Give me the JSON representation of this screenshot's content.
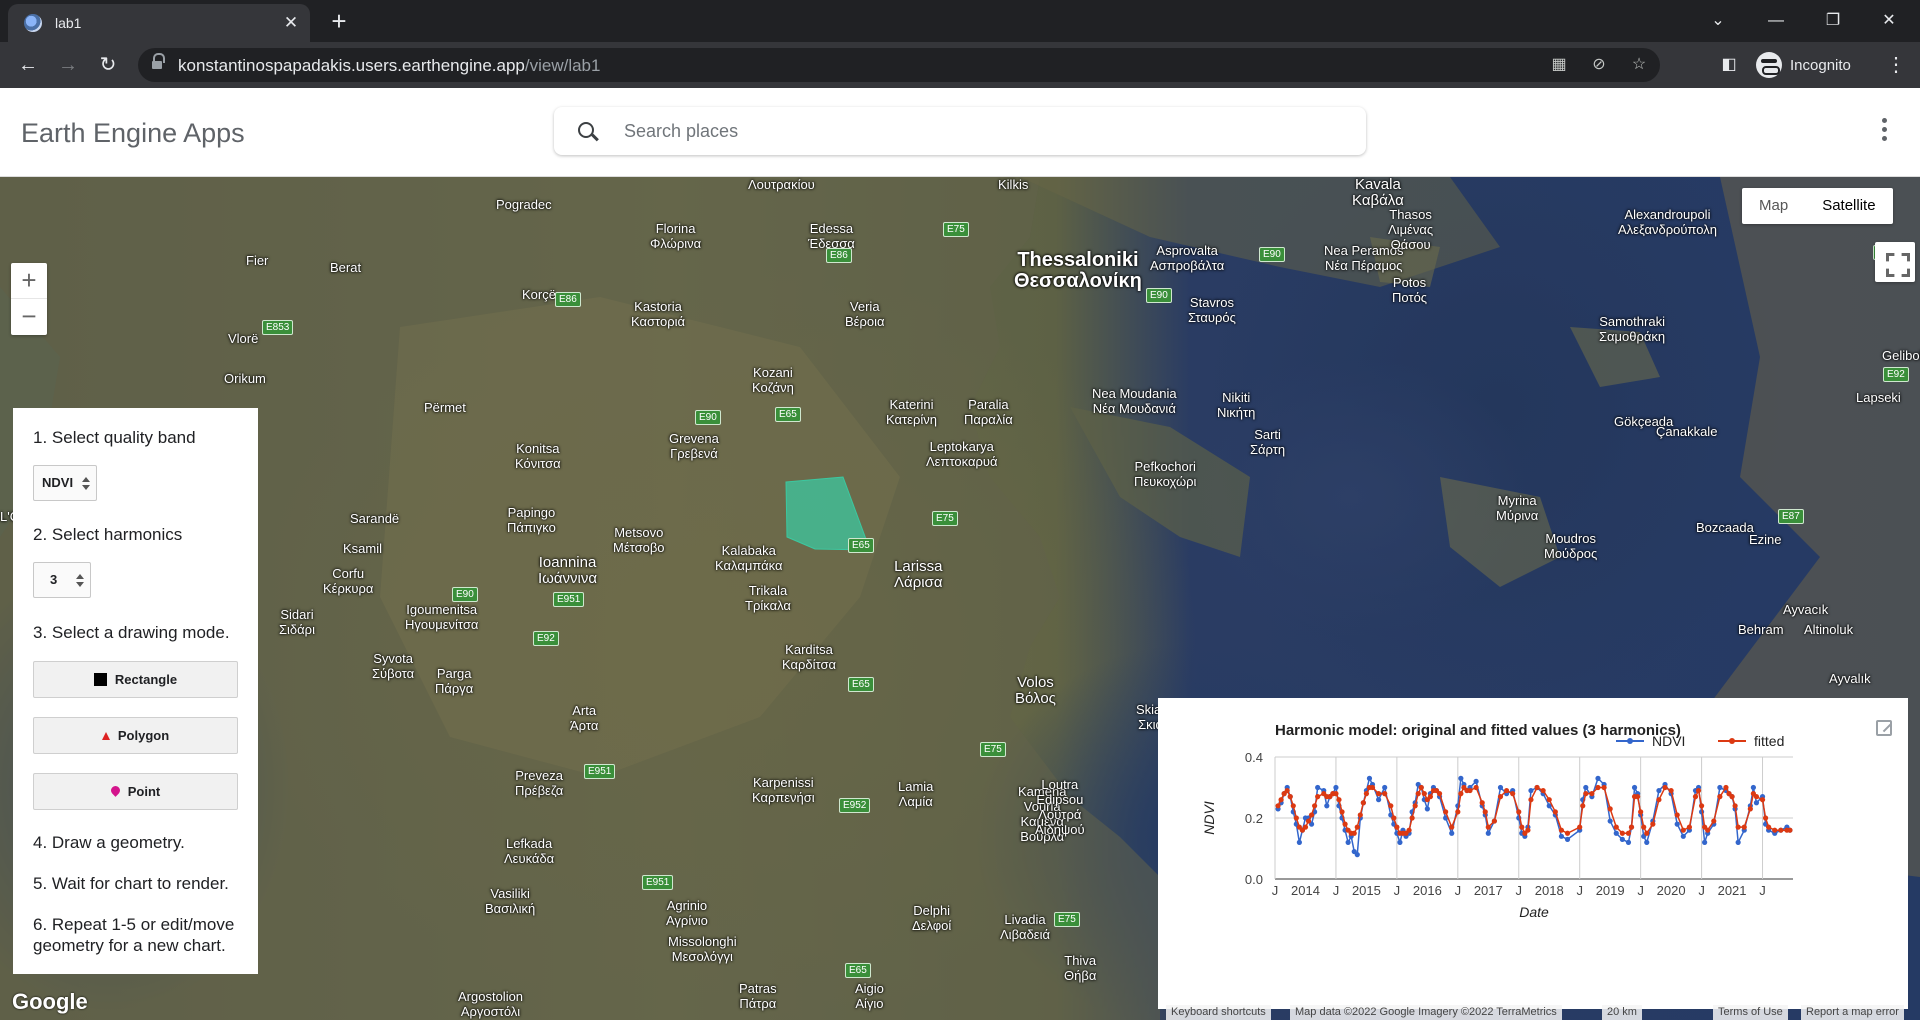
{
  "browser": {
    "tab_title": "lab1",
    "url_host": "konstantinospapadakis.users.earthengine.app",
    "url_path": "/view/lab1",
    "profile_label": "Incognito"
  },
  "header": {
    "app_title": "Earth Engine Apps",
    "search_placeholder": "Search places"
  },
  "map": {
    "type_buttons": [
      "Map",
      "Satellite"
    ],
    "active_type": "Satellite",
    "zoom_in": "+",
    "zoom_out": "−",
    "labels": [
      "Λουτρακίου",
      "Kilkis",
      "Kavala\nΚαβάλα",
      "Pogradec",
      "Florina\nΦλώρινα",
      "Edessa\nΈδεσσα",
      "Thessaloniki\nΘεσσαλονίκη",
      "Asprovalta\nΑσπροβάλτα",
      "Nea Peramos\nΝέα Πέραμος",
      "Thasos\nΛιμένας\nΘάσου",
      "Alexandroupoli\nΑλεξανδρούπολη",
      "Fier",
      "Berat",
      "Korçë",
      "Kastoria\nΚαστοριά",
      "Veria\nΒέροια",
      "Stavros\nΣταυρός",
      "Potos\nΠοτός",
      "Samothraki\nΣαμοθράκη",
      "Vlorë",
      "Orikum",
      "Përmet",
      "Kozani\nΚοζάνη",
      "Katerini\nΚατερίνη",
      "Paralia\nΠαραλία",
      "Nea Moudania\nΝέα Μουδανιά",
      "Nikiti\nΝικήτη",
      "Gelibolu",
      "Lapseki",
      "Gökçeada",
      "Çanakkale",
      "Konitsa\nΚόνιτσα",
      "Grevena\nΓρεβενά",
      "Leptokarya\nΛεπτοκαρυά",
      "Sarti\nΣάρτη",
      "Pefkochori\nΠευκοχώρι",
      "Sarandë",
      "Papingo\nΠάπιγκο",
      "Metsovo\nΜέτσοβο",
      "Kalabaka\nΚαλαμπάκα",
      "Larissa\nΛάρισα",
      "Myrina\nΜύρινα",
      "Moudros\nΜούδρος",
      "Bozcaada",
      "Ezine",
      "Ksamil",
      "Ioannina\nΙωάννινα",
      "Corfu\nΚέρκυρα",
      "Trikala\nΤρίκαλα",
      "Igoumenitsa\nΗγουμενίτσα",
      "Karditsa\nΚαρδίτσα",
      "Volos\nΒόλος",
      "Ayvacık",
      "Behram",
      "Altinoluk",
      "Syvota\nΣύβοτα",
      "Parga\nΠάργα",
      "Ayvalık",
      "Skiathos\nΣκιάθος",
      "Arta\nΆρτα",
      "Preveza\nΠρέβεζα",
      "Karpenissi\nΚαρπενήσι",
      "Lamia\nΛαμία",
      "Kamena\nVourla\nΚαμένα\nΒούρλα",
      "Loutra\nEdipsou\nΛουτρά\nΑιδηψού",
      "Lefkada\nΛευκάδα",
      "Vasiliki\nΒασιλική",
      "Agrinio\nΑγρίνιο",
      "Missolonghi\nΜεσολόγγι",
      "Delphi\nΔελφοί",
      "Livadia\nΛιβαδειά",
      "Thiva\nΘήβα",
      "Patras\nΠάτρα",
      "Aigio\nΑίγιο",
      "Argostolion\nΑργοστόλι",
      "Sidari\nΣιδάρι",
      "L'Orso"
    ],
    "road_shields": [
      "E75",
      "E86",
      "E90",
      "E853",
      "E86",
      "E90",
      "E65",
      "E87",
      "E90",
      "E65",
      "E75",
      "E92",
      "E90",
      "E951",
      "E92",
      "E87",
      "E65",
      "E75",
      "E951",
      "E952",
      "E951",
      "E75",
      "E65"
    ],
    "google_logo": "Google",
    "attribution": {
      "shortcuts": "Keyboard shortcuts",
      "data": "Map data ©2022 Google Imagery ©2022 TerraMetrics",
      "scale": "20 km",
      "terms": "Terms of Use",
      "report": "Report a map error"
    },
    "aoi_color": "#3cc8a0"
  },
  "panel": {
    "step1": "1. Select quality band",
    "band_value": "NDVI",
    "step2": "2. Select harmonics",
    "harmonics_value": "3",
    "step3": "3. Select a drawing mode.",
    "btn_rectangle": "Rectangle",
    "btn_polygon": "Polygon",
    "btn_point": "Point",
    "step4": "4. Draw a geometry.",
    "step5": "5. Wait for chart to render.",
    "step6": "6. Repeat 1-5 or edit/move geometry for a new chart."
  },
  "chart_data": {
    "type": "line",
    "title": "Harmonic model: original and fitted values (3 harmonics)",
    "xlabel": "Date",
    "ylabel": "NDVI",
    "ylim": [
      0,
      0.4
    ],
    "yticks": [
      "0.0",
      "0.2",
      "0.4"
    ],
    "xticks": [
      "J",
      "2014",
      "J",
      "2015",
      "J",
      "2016",
      "J",
      "2017",
      "J",
      "2018",
      "J",
      "2019",
      "J",
      "2020",
      "J",
      "2021",
      "J"
    ],
    "xlim": [
      2013.5,
      2022.0
    ],
    "legend_position": "top-right",
    "series": [
      {
        "name": "NDVI",
        "color": "#3366cc",
        "x": [
          2013.55,
          2013.6,
          2013.65,
          2013.7,
          2013.75,
          2013.8,
          2013.85,
          2013.9,
          2013.95,
          2014.0,
          2014.05,
          2014.1,
          2014.15,
          2014.2,
          2014.3,
          2014.35,
          2014.4,
          2014.45,
          2014.5,
          2014.55,
          2014.6,
          2014.65,
          2014.7,
          2014.75,
          2014.8,
          2014.85,
          2014.9,
          2014.95,
          2015.0,
          2015.05,
          2015.1,
          2015.2,
          2015.3,
          2015.4,
          2015.45,
          2015.5,
          2015.55,
          2015.6,
          2015.65,
          2015.7,
          2015.75,
          2015.8,
          2015.85,
          2015.9,
          2015.95,
          2016.0,
          2016.05,
          2016.1,
          2016.15,
          2016.2,
          2016.3,
          2016.4,
          2016.5,
          2016.55,
          2016.6,
          2016.65,
          2016.7,
          2016.8,
          2016.9,
          2016.95,
          2017.0,
          2017.1,
          2017.2,
          2017.3,
          2017.4,
          2017.5,
          2017.55,
          2017.6,
          2017.65,
          2017.7,
          2017.8,
          2017.9,
          2018.0,
          2018.1,
          2018.2,
          2018.3,
          2018.5,
          2018.55,
          2018.6,
          2018.7,
          2018.8,
          2018.9,
          2019.0,
          2019.1,
          2019.2,
          2019.3,
          2019.35,
          2019.4,
          2019.45,
          2019.5,
          2019.55,
          2019.6,
          2019.7,
          2019.8,
          2019.9,
          2020.0,
          2020.1,
          2020.2,
          2020.3,
          2020.4,
          2020.45,
          2020.5,
          2020.55,
          2020.6,
          2020.7,
          2020.8,
          2020.9,
          2020.95,
          2021.0,
          2021.05,
          2021.1,
          2021.2,
          2021.3,
          2021.35,
          2021.4,
          2021.5,
          2021.55,
          2021.6,
          2021.7,
          2021.8,
          2021.9,
          2021.95
        ],
        "values": [
          0.23,
          0.25,
          0.28,
          0.3,
          0.27,
          0.22,
          0.18,
          0.12,
          0.16,
          0.2,
          0.2,
          0.18,
          0.22,
          0.3,
          0.29,
          0.24,
          0.27,
          0.28,
          0.3,
          0.24,
          0.2,
          0.16,
          0.12,
          0.14,
          0.09,
          0.08,
          0.2,
          0.25,
          0.29,
          0.33,
          0.31,
          0.26,
          0.3,
          0.21,
          0.18,
          0.15,
          0.12,
          0.16,
          0.14,
          0.15,
          0.22,
          0.25,
          0.31,
          0.3,
          0.26,
          0.23,
          0.28,
          0.3,
          0.29,
          0.27,
          0.2,
          0.15,
          0.24,
          0.33,
          0.31,
          0.29,
          0.3,
          0.32,
          0.24,
          0.21,
          0.15,
          0.19,
          0.3,
          0.28,
          0.29,
          0.2,
          0.15,
          0.14,
          0.17,
          0.29,
          0.3,
          0.28,
          0.24,
          0.21,
          0.14,
          0.13,
          0.16,
          0.26,
          0.3,
          0.27,
          0.33,
          0.31,
          0.19,
          0.15,
          0.13,
          0.12,
          0.17,
          0.3,
          0.28,
          0.21,
          0.14,
          0.12,
          0.19,
          0.29,
          0.31,
          0.28,
          0.18,
          0.14,
          0.16,
          0.29,
          0.3,
          0.22,
          0.12,
          0.15,
          0.18,
          0.3,
          0.29,
          0.28,
          0.27,
          0.23,
          0.12,
          0.16,
          0.24,
          0.3,
          0.25,
          0.27,
          0.18,
          0.16,
          0.15,
          0.16,
          0.17,
          0.16
        ]
      },
      {
        "name": "fitted",
        "color": "#dc3912",
        "x": [
          2013.55,
          2013.6,
          2013.65,
          2013.7,
          2013.75,
          2013.8,
          2013.85,
          2013.9,
          2013.95,
          2014.0,
          2014.05,
          2014.1,
          2014.15,
          2014.2,
          2014.3,
          2014.35,
          2014.4,
          2014.45,
          2014.5,
          2014.55,
          2014.6,
          2014.65,
          2014.7,
          2014.75,
          2014.8,
          2014.85,
          2014.9,
          2014.95,
          2015.0,
          2015.05,
          2015.1,
          2015.2,
          2015.3,
          2015.4,
          2015.45,
          2015.5,
          2015.55,
          2015.6,
          2015.65,
          2015.7,
          2015.75,
          2015.8,
          2015.85,
          2015.9,
          2015.95,
          2016.0,
          2016.05,
          2016.1,
          2016.15,
          2016.2,
          2016.3,
          2016.4,
          2016.5,
          2016.55,
          2016.6,
          2016.65,
          2016.7,
          2016.8,
          2016.9,
          2016.95,
          2017.0,
          2017.1,
          2017.2,
          2017.3,
          2017.4,
          2017.5,
          2017.55,
          2017.6,
          2017.65,
          2017.7,
          2017.8,
          2017.9,
          2018.0,
          2018.1,
          2018.2,
          2018.3,
          2018.5,
          2018.55,
          2018.6,
          2018.7,
          2018.8,
          2018.9,
          2019.0,
          2019.1,
          2019.2,
          2019.3,
          2019.35,
          2019.4,
          2019.45,
          2019.5,
          2019.55,
          2019.6,
          2019.7,
          2019.8,
          2019.9,
          2020.0,
          2020.1,
          2020.2,
          2020.3,
          2020.4,
          2020.45,
          2020.5,
          2020.55,
          2020.6,
          2020.7,
          2020.8,
          2020.9,
          2020.95,
          2021.0,
          2021.05,
          2021.1,
          2021.2,
          2021.3,
          2021.35,
          2021.4,
          2021.5,
          2021.55,
          2021.6,
          2021.7,
          2021.8,
          2021.9,
          2021.95
        ],
        "values": [
          0.24,
          0.26,
          0.28,
          0.29,
          0.27,
          0.24,
          0.2,
          0.17,
          0.16,
          0.17,
          0.19,
          0.21,
          0.24,
          0.27,
          0.28,
          0.27,
          0.27,
          0.28,
          0.28,
          0.26,
          0.22,
          0.18,
          0.16,
          0.15,
          0.15,
          0.17,
          0.21,
          0.25,
          0.28,
          0.3,
          0.3,
          0.28,
          0.28,
          0.24,
          0.2,
          0.17,
          0.15,
          0.15,
          0.15,
          0.16,
          0.2,
          0.24,
          0.28,
          0.3,
          0.28,
          0.26,
          0.27,
          0.29,
          0.29,
          0.28,
          0.22,
          0.17,
          0.22,
          0.28,
          0.3,
          0.29,
          0.29,
          0.3,
          0.25,
          0.22,
          0.17,
          0.19,
          0.27,
          0.29,
          0.28,
          0.22,
          0.17,
          0.15,
          0.16,
          0.26,
          0.3,
          0.29,
          0.26,
          0.22,
          0.16,
          0.15,
          0.17,
          0.24,
          0.28,
          0.28,
          0.3,
          0.3,
          0.23,
          0.17,
          0.15,
          0.15,
          0.17,
          0.27,
          0.27,
          0.22,
          0.17,
          0.15,
          0.18,
          0.26,
          0.3,
          0.29,
          0.21,
          0.16,
          0.17,
          0.27,
          0.29,
          0.24,
          0.17,
          0.16,
          0.19,
          0.27,
          0.3,
          0.28,
          0.27,
          0.24,
          0.17,
          0.17,
          0.23,
          0.28,
          0.27,
          0.26,
          0.2,
          0.17,
          0.16,
          0.16,
          0.16,
          0.16
        ]
      }
    ]
  }
}
